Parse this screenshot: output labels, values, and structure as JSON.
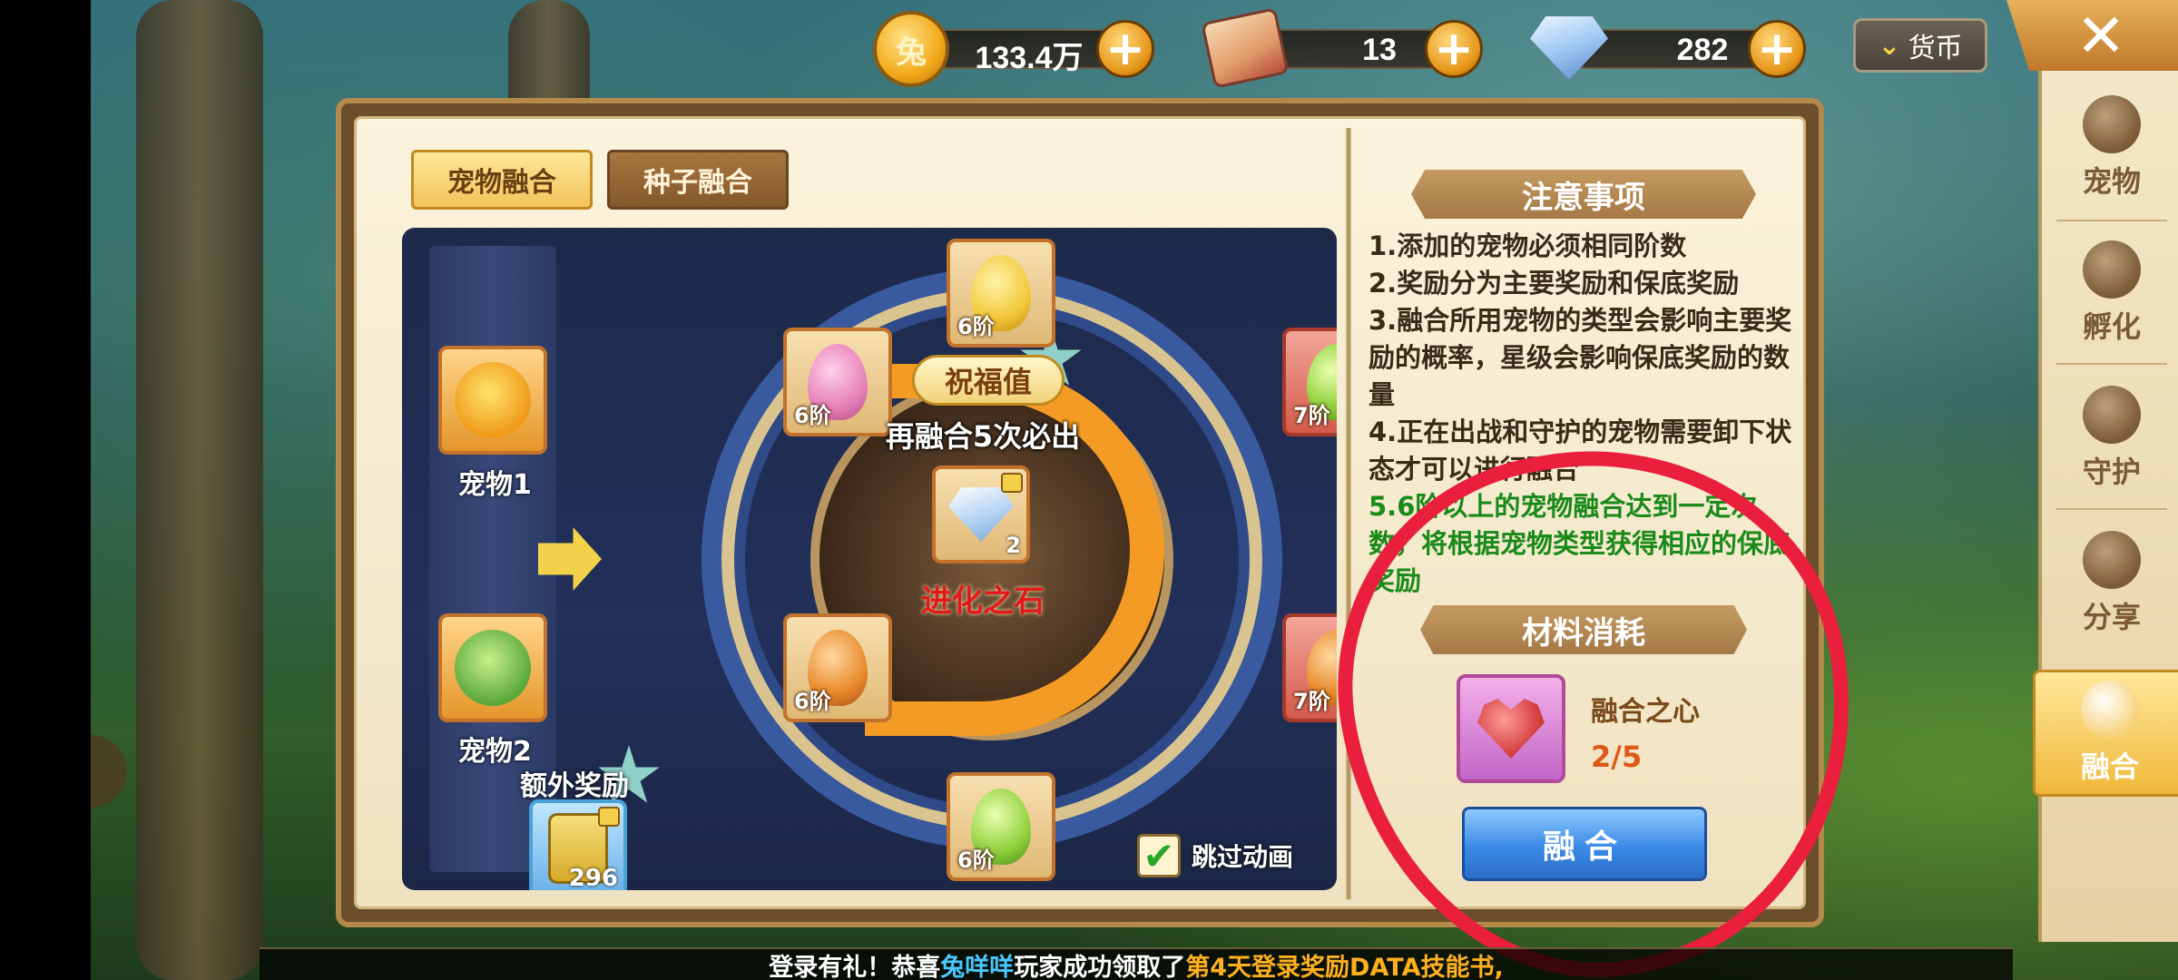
{
  "currency": {
    "gold": {
      "value": "133.4万",
      "icon": "gold-coin-icon"
    },
    "scroll": {
      "value": "13",
      "icon": "scroll-icon"
    },
    "diamond": {
      "value": "282",
      "icon": "diamond-icon"
    },
    "toggle_label": "货币",
    "plus_symbol": "+",
    "close_symbol": "✕",
    "toggle_chevron": "⌄"
  },
  "right_nav": {
    "items": [
      {
        "label": "宠物",
        "icon": "pet-icon"
      },
      {
        "label": "孵化",
        "icon": "egg-icon"
      },
      {
        "label": "守护",
        "icon": "guard-icon"
      },
      {
        "label": "分享",
        "icon": "share-icon"
      },
      {
        "label": "融合",
        "icon": "fusion-icon",
        "active": true
      }
    ]
  },
  "tabs": {
    "pet_fusion": "宠物融合",
    "seed_fusion": "种子融合"
  },
  "fusion": {
    "pet1_label": "宠物1",
    "pet2_label": "宠物2",
    "blessing_label": "祝福值",
    "guarantee_text": "再融合5次必出",
    "reward_name": "进化之石",
    "reward_count": "2",
    "blessing_progress": 0.5,
    "slots": [
      {
        "tier": "6阶",
        "color": "yellow"
      },
      {
        "tier": "6阶",
        "color": "pink"
      },
      {
        "tier": "7阶",
        "color": "green"
      },
      {
        "tier": "6阶",
        "color": "orange"
      },
      {
        "tier": "7阶",
        "color": "orange"
      },
      {
        "tier": "6阶",
        "color": "green"
      }
    ],
    "extra_reward_label": "额外奖励",
    "extra_reward_count": "296",
    "skip_animation_label": "跳过动画",
    "skip_animation_checked": true,
    "check_symbol": "✔"
  },
  "notes": {
    "title": "注意事项",
    "items": [
      "1.添加的宠物必须相同阶数",
      "2.奖励分为主要奖励和保底奖励",
      "3.融合所用宠物的类型会影响主要奖励的概率，星级会影响保底奖励的数量",
      "4.正在出战和守护的宠物需要卸下状态才可以进行融合"
    ],
    "highlight": "5.6阶以上的宠物融合达到一定次数，将根据宠物类型获得相应的保底奖励"
  },
  "materials": {
    "title": "材料消耗",
    "name": "融合之心",
    "count": "2/5",
    "fuse_button": "融合"
  },
  "ticker": {
    "prefix": "登录有礼！恭喜",
    "player": "兔咩咩",
    "middle": "玩家成功领取了",
    "reward": "第4天登录奖励",
    "suffix": "DATA技能书,"
  },
  "colors": {
    "accent_gold": "#f2c45a",
    "fuse_blue": "#3a8ae6",
    "red_marker": "#ea1f3e",
    "highlight_green": "#1a8a1a",
    "stone_red": "#e41a1a"
  }
}
